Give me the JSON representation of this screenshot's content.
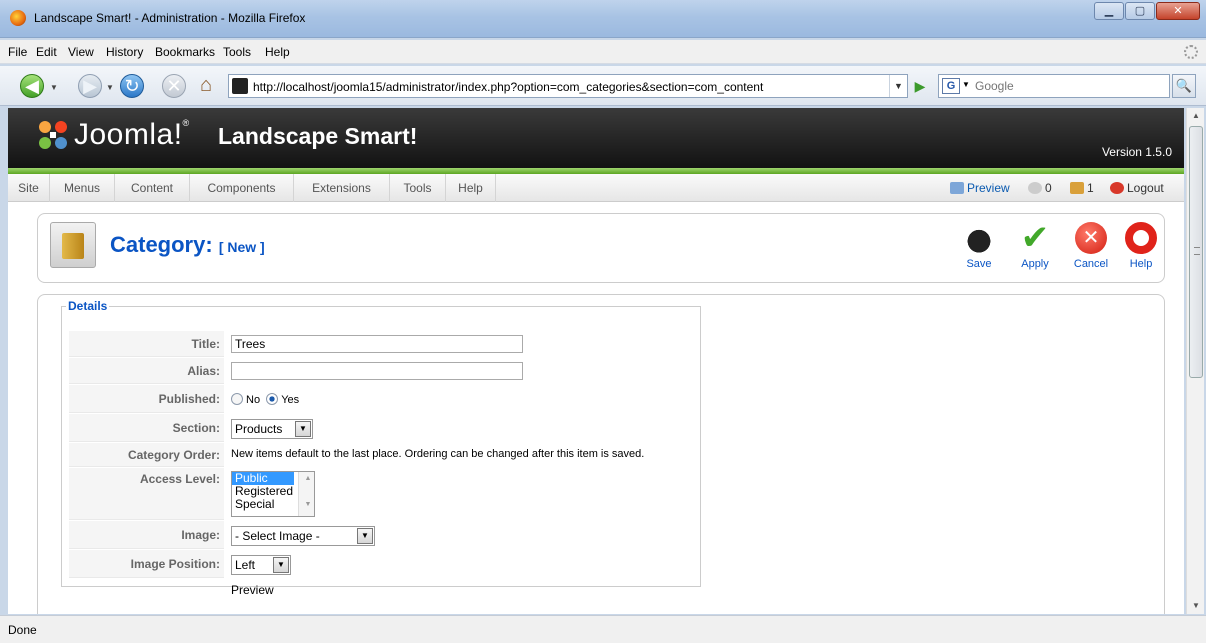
{
  "window": {
    "title": "Landscape Smart! - Administration - Mozilla Firefox",
    "min_icon": "minimize-icon",
    "max_icon": "maximize-icon",
    "close_icon": "close-icon"
  },
  "menubar": [
    "File",
    "Edit",
    "View",
    "History",
    "Bookmarks",
    "Tools",
    "Help"
  ],
  "navbar": {
    "url": "http://localhost/joomla15/administrator/index.php?option=com_categories&section=com_content",
    "search_placeholder": "Google",
    "search_engine": "G"
  },
  "joomla": {
    "brand": "Joomla!",
    "tm": "®",
    "site_name": "Landscape Smart!",
    "version": "Version 1.5.0",
    "menu": [
      "Site",
      "Menus",
      "Content",
      "Components",
      "Extensions",
      "Tools",
      "Help"
    ],
    "status": {
      "preview": "Preview",
      "messages": "0",
      "users": "1",
      "logout": "Logout"
    }
  },
  "toolbar": {
    "title": "Category:",
    "subtitle": "[ New ]",
    "buttons": {
      "save": "Save",
      "apply": "Apply",
      "cancel": "Cancel",
      "help": "Help"
    }
  },
  "details": {
    "legend": "Details",
    "fields": {
      "title_label": "Title:",
      "title_value": "Trees",
      "alias_label": "Alias:",
      "alias_value": "",
      "published_label": "Published:",
      "published_no": "No",
      "published_yes": "Yes",
      "published_selected": "Yes",
      "section_label": "Section:",
      "section_value": "Products",
      "order_label": "Category Order:",
      "order_text": "New items default to the last place. Ordering can be changed after this item is saved.",
      "access_label": "Access Level:",
      "access_options": [
        "Public",
        "Registered",
        "Special"
      ],
      "access_selected": "Public",
      "image_label": "Image:",
      "image_value": "- Select Image -",
      "image_position_label": "Image Position:",
      "image_position_value": "Left",
      "preview_text": "Preview"
    }
  },
  "statusbar": {
    "text": "Done"
  },
  "colors": {
    "joomla_blue": "#0b55c4",
    "header_black": "#111111",
    "accent_green": "#5ca623"
  }
}
